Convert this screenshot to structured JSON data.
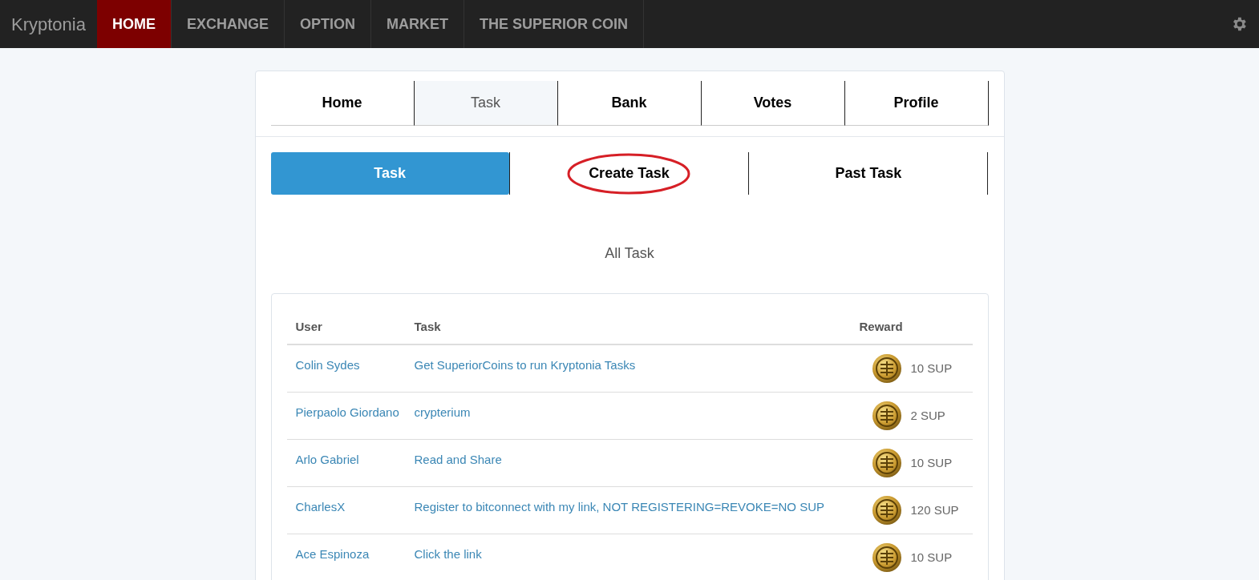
{
  "navbar": {
    "brand": "Kryptonia",
    "items": [
      {
        "label": "HOME",
        "selected": true
      },
      {
        "label": "EXCHANGE",
        "selected": false
      },
      {
        "label": "OPTION",
        "selected": false
      },
      {
        "label": "MARKET",
        "selected": false
      },
      {
        "label": "THE SUPERIOR COIN",
        "selected": false
      }
    ]
  },
  "tabs": [
    {
      "label": "Home",
      "selected": false
    },
    {
      "label": "Task",
      "selected": true
    },
    {
      "label": "Bank",
      "selected": false
    },
    {
      "label": "Votes",
      "selected": false
    },
    {
      "label": "Profile",
      "selected": false
    }
  ],
  "subtabs": [
    {
      "label": "Task",
      "selected": true,
      "circled": false
    },
    {
      "label": "Create Task",
      "selected": false,
      "circled": true
    },
    {
      "label": "Past Task",
      "selected": false,
      "circled": false
    }
  ],
  "section_title": "All Task",
  "table": {
    "columns": [
      "User",
      "Task",
      "Reward"
    ],
    "rows": [
      {
        "user": "Colin Sydes",
        "task": "Get SuperiorCoins to run Kryptonia Tasks",
        "reward": "10 SUP"
      },
      {
        "user": "Pierpaolo Giordano",
        "task": "crypterium",
        "reward": "2 SUP"
      },
      {
        "user": "Arlo Gabriel",
        "task": "Read and Share",
        "reward": "10 SUP"
      },
      {
        "user": "CharlesX",
        "task": "Register to bitconnect with my link, NOT REGISTERING=REVOKE=NO SUP",
        "reward": "120 SUP"
      },
      {
        "user": "Ace Espinoza",
        "task": "Click the link",
        "reward": "10 SUP"
      }
    ]
  }
}
